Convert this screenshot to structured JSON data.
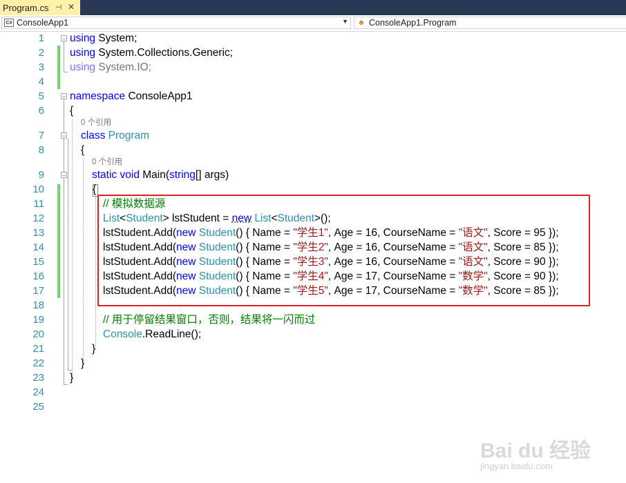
{
  "tab": {
    "label": "Program.cs",
    "pin_icon": "pin-icon",
    "close_icon": "close-icon"
  },
  "nav": {
    "project": "ConsoleApp1",
    "member": "ConsoleApp1.Program"
  },
  "line_numbers": [
    "1",
    "2",
    "3",
    "4",
    "5",
    "6",
    "7",
    "8",
    "9",
    "10",
    "11",
    "12",
    "13",
    "14",
    "15",
    "16",
    "17",
    "18",
    "19",
    "20",
    "21",
    "22",
    "23",
    "24",
    "25"
  ],
  "codelens": {
    "program_refs": "0 个引用",
    "main_refs": "0 个引用"
  },
  "code": {
    "l1_kw": "using",
    "l1_rest": " System;",
    "l2_kw": "using",
    "l2_rest": " System.Collections.Generic;",
    "l3_kw": "using",
    "l3_rest": " System.IO;",
    "l5_kw": "namespace",
    "l5_rest": " ConsoleApp1",
    "brace_open": "{",
    "brace_close": "}",
    "l7_kw": "class",
    "l7_type": "Program",
    "l9_kw1": "static",
    "l9_kw2": "void",
    "l9_name": " Main(",
    "l9_kw3": "string",
    "l9_rest": "[] args)",
    "l11_comment": "// 模拟数据源",
    "l12": {
      "t1": "List",
      "p1": "<",
      "t2": "Student",
      "p2": "> lstStudent = ",
      "kw": "new",
      "sp": " ",
      "t3": "List",
      "p3": "<",
      "t4": "Student",
      "p4": ">();"
    },
    "add_prefix": "lstStudent.Add(",
    "new_kw": "new",
    "student_type": "Student",
    "add_mid1": "() { Name = ",
    "add_mid2": ", Age = ",
    "add_mid3": ", CourseName = ",
    "add_mid4": ", Score = ",
    "add_end": " });",
    "rows": [
      {
        "name": "\"学生1\"",
        "age": "16",
        "course": "\"语文\"",
        "score": "95"
      },
      {
        "name": "\"学生2\"",
        "age": "16",
        "course": "\"语文\"",
        "score": "85"
      },
      {
        "name": "\"学生3\"",
        "age": "16",
        "course": "\"语文\"",
        "score": "90"
      },
      {
        "name": "\"学生4\"",
        "age": "17",
        "course": "\"数学\"",
        "score": "90"
      },
      {
        "name": "\"学生5\"",
        "age": "17",
        "course": "\"数学\"",
        "score": "85"
      }
    ],
    "l19_comment": "// 用于停留结果窗口，否则，结果将一闪而过",
    "l20_type": "Console",
    "l20_rest": ".ReadLine();"
  },
  "watermark": {
    "text": "Bai du 经验",
    "url": "jingyan.baidu.com"
  },
  "colors": {
    "keyword": "#0000ff",
    "type": "#2b91af",
    "string": "#a31515",
    "comment": "#008000",
    "tab_active": "#fff1a8",
    "tab_bar": "#293955",
    "highlight_box": "#e02020",
    "change_bar": "#6ed46c"
  }
}
